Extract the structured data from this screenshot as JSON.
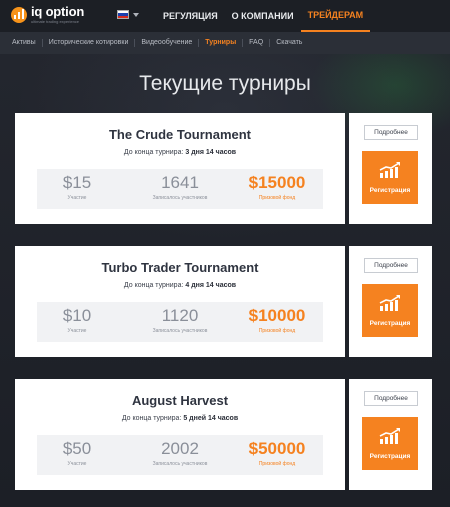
{
  "header": {
    "logo_text": "iq option",
    "logo_sub": "ultimate trading experience",
    "nav": [
      {
        "label": "РЕГУЛЯЦИЯ"
      },
      {
        "label": "О КОМПАНИИ"
      },
      {
        "label": "ТРЕЙДЕРАМ"
      }
    ],
    "flag_colors": [
      "#ffffff",
      "#1c3fae",
      "#d52b1e"
    ]
  },
  "subnav": [
    {
      "label": "Активы"
    },
    {
      "label": "Исторические котировки"
    },
    {
      "label": "Видеообучение"
    },
    {
      "label": "Турниры"
    },
    {
      "label": "FAQ"
    },
    {
      "label": "Скачать"
    }
  ],
  "page_title": "Текущие турниры",
  "tournaments": [
    {
      "name": "The Crude Tournament",
      "time_prefix": "До конца турнира:",
      "time_value": "3 дня  14 часов",
      "entry_fee": "$15",
      "entry_label": "Участие",
      "participants": "1641",
      "participants_label": "Записалось участников",
      "prize": "$15000",
      "prize_label": "Призовой фонд",
      "more_label": "Подробнее",
      "register_label": "Регистрация"
    },
    {
      "name": "Turbo Trader Tournament",
      "time_prefix": "До конца турнира:",
      "time_value": "4 дня  14 часов",
      "entry_fee": "$10",
      "entry_label": "Участие",
      "participants": "1120",
      "participants_label": "Записалось участников",
      "prize": "$10000",
      "prize_label": "Призовой фонд",
      "more_label": "Подробнее",
      "register_label": "Регистрация"
    },
    {
      "name": "August Harvest",
      "time_prefix": "До конца турнира:",
      "time_value": "5 дней  14 часов",
      "entry_fee": "$50",
      "entry_label": "Участие",
      "participants": "2002",
      "participants_label": "Записалось участников",
      "prize": "$50000",
      "prize_label": "Призовой фонд",
      "more_label": "Подробнее",
      "register_label": "Регистрация"
    }
  ],
  "colors": {
    "accent": "#f58220",
    "header_bg": "#1c1f25",
    "subnav_bg": "#2b2f37"
  }
}
